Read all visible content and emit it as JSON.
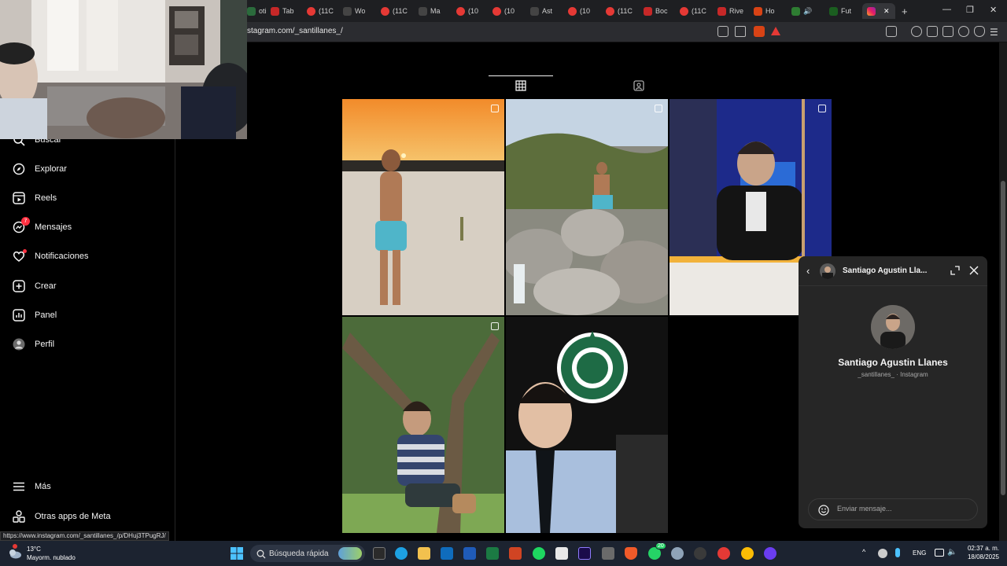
{
  "browser": {
    "url": "stagram.com/_santillanes_/",
    "tabs": [
      {
        "label": "oti",
        "color": "#2b6b3c"
      },
      {
        "label": "Tab",
        "color": "#c62828"
      },
      {
        "label": "(11C",
        "color": "#e53935"
      },
      {
        "label": "Wo",
        "color": "#444444"
      },
      {
        "label": "(11C",
        "color": "#e53935"
      },
      {
        "label": "Ma",
        "color": "#444444"
      },
      {
        "label": "(10",
        "color": "#e53935"
      },
      {
        "label": "(10",
        "color": "#e53935"
      },
      {
        "label": "Ast",
        "color": "#444444"
      },
      {
        "label": "(10",
        "color": "#e53935"
      },
      {
        "label": "(11C",
        "color": "#e53935"
      },
      {
        "label": "Boc",
        "color": "#c62828"
      },
      {
        "label": "(11C",
        "color": "#e53935"
      },
      {
        "label": "Rive",
        "color": "#c62828"
      },
      {
        "label": "Ho",
        "color": "#d84315"
      },
      {
        "label": "",
        "color": "#2e7d32"
      },
      {
        "label": "Fut",
        "color": "#1b5e20"
      }
    ],
    "new_tab": "+"
  },
  "sidebar": {
    "items": [
      {
        "label": "Buscar",
        "icon": "search-icon"
      },
      {
        "label": "Explorar",
        "icon": "compass-icon"
      },
      {
        "label": "Reels",
        "icon": "reels-icon"
      },
      {
        "label": "Mensajes",
        "icon": "messenger-icon",
        "badge": "7"
      },
      {
        "label": "Notificaciones",
        "icon": "heart-icon"
      },
      {
        "label": "Crear",
        "icon": "plus-square-icon"
      },
      {
        "label": "Panel",
        "icon": "chart-icon"
      },
      {
        "label": "Perfil",
        "icon": "avatar-icon"
      }
    ],
    "more": "Más",
    "meta": "Otras apps de Meta"
  },
  "chat": {
    "header_name": "Santiago Agustin Lla...",
    "profile_name": "Santiago Agustin Llanes",
    "profile_sub": "_santillanes_ · Instagram",
    "placeholder": "Enviar mensaje..."
  },
  "status_url": "https://www.instagram.com/_santillanes_/p/DHuj3TPugRJ/",
  "taskbar": {
    "temp": "13°C",
    "weather": "Mayorm. nublado",
    "search": "Búsqueda rápida",
    "lang": "ENG",
    "time": "02:37 a. m.",
    "date": "18/08/2025",
    "whatsapp_badge": "20"
  },
  "colors": {
    "accent": "#0095f6",
    "notification": "#ff3040",
    "background": "#000000"
  }
}
